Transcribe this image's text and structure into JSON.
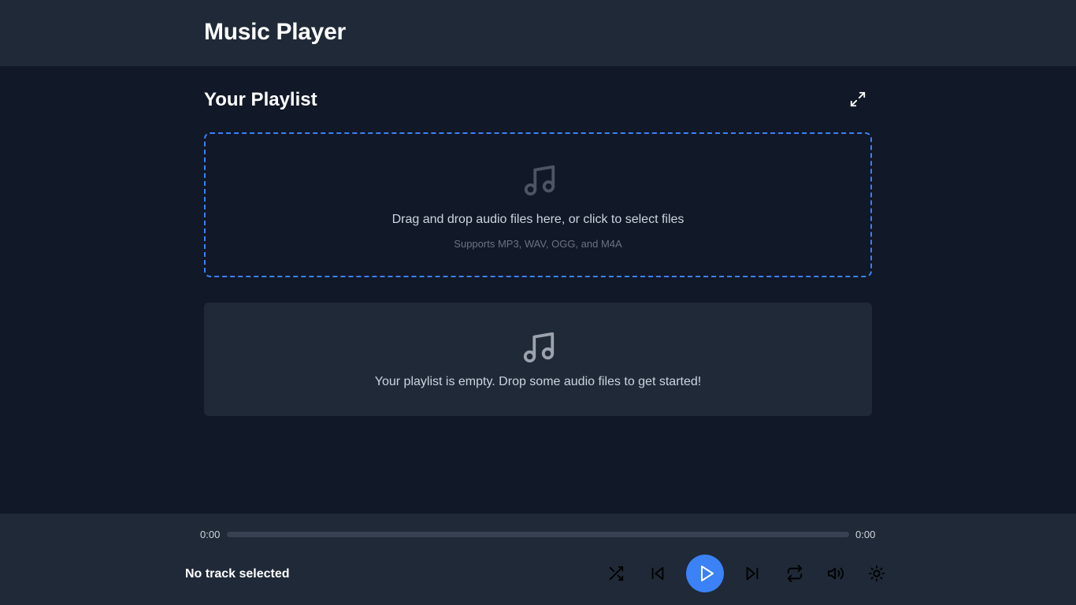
{
  "header": {
    "title": "Music Player"
  },
  "playlist": {
    "title": "Your Playlist",
    "expand_icon": "expand-icon",
    "dropzone": {
      "icon": "music-note-icon",
      "main_text": "Drag and drop audio files here, or click to select files",
      "sub_text": "Supports MP3, WAV, OGG, and M4A"
    },
    "empty": {
      "icon": "music-note-icon",
      "text": "Your playlist is empty. Drop some audio files to get started!"
    }
  },
  "player": {
    "current_time": "0:00",
    "total_time": "0:00",
    "progress": 0,
    "track_name": "No track selected",
    "controls": [
      "shuffle-icon",
      "previous-icon",
      "play-icon",
      "next-icon",
      "repeat-icon",
      "volume-icon",
      "sun-icon"
    ]
  },
  "colors": {
    "background": "#111827",
    "surface": "#1f2937",
    "accent": "#3b82f6",
    "muted_text": "#6b7280",
    "body_text": "#cbd5e1"
  }
}
